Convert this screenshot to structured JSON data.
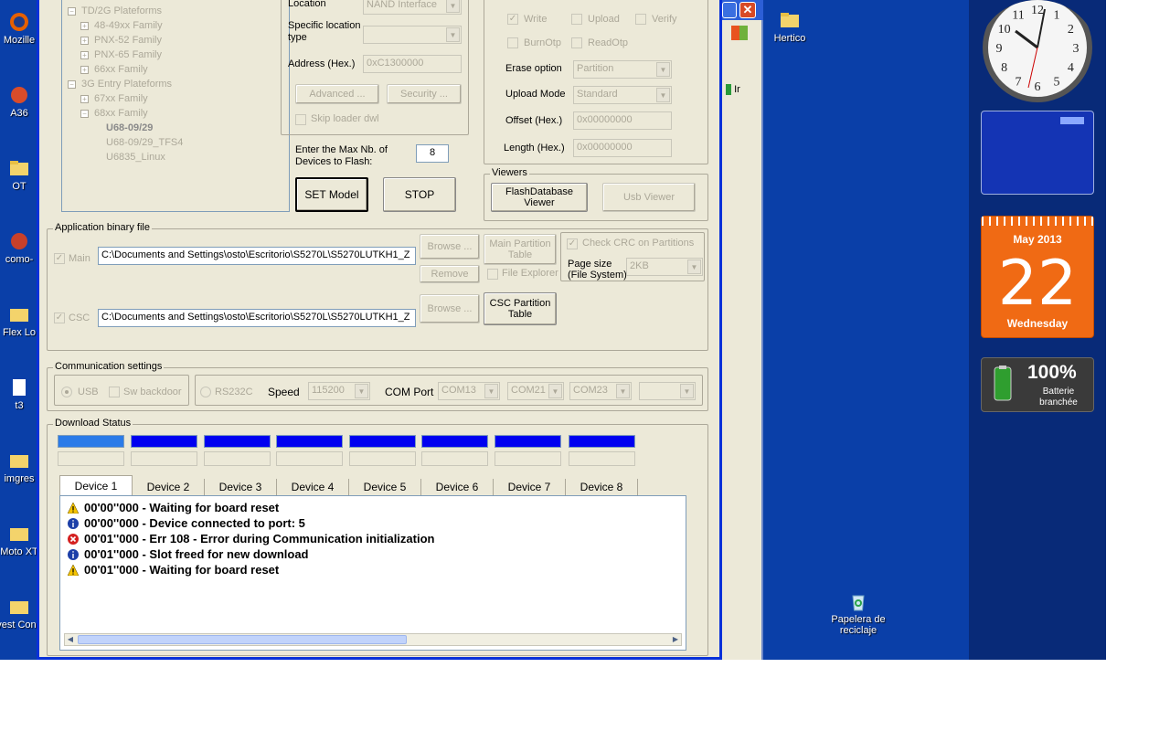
{
  "tree": {
    "items": [
      {
        "label": "TD/2G Plateforms",
        "sign": "−"
      },
      {
        "label": "48-49xx Family",
        "sign": "+"
      },
      {
        "label": "PNX-52 Family",
        "sign": "+"
      },
      {
        "label": "PNX-65 Family",
        "sign": "+"
      },
      {
        "label": "66xx Family",
        "sign": "+"
      },
      {
        "label": "3G Entry Plateforms",
        "sign": "−"
      },
      {
        "label": "67xx Family",
        "sign": "+"
      },
      {
        "label": "68xx Family",
        "sign": "−"
      },
      {
        "label": "U68-09/29",
        "sign": ""
      },
      {
        "label": "U68-09/29_TFS4",
        "sign": ""
      },
      {
        "label": "U6835_Linux",
        "sign": ""
      }
    ]
  },
  "location": {
    "label": "Location",
    "value": "NAND Interface",
    "specific_label": "Specific location type",
    "specific_value": "",
    "address_label": "Address (Hex.)",
    "address_value": "0xC1300000",
    "advanced_label": "Advanced ...",
    "security_label": "Security ...",
    "skip_loader_label": "Skip loader dwl"
  },
  "devices": {
    "max_label": "Enter the Max Nb. of Devices to Flash:",
    "max_value": "8",
    "set_model_label": "SET Model",
    "stop_label": "STOP"
  },
  "options": {
    "write_label": "Write",
    "upload_label": "Upload",
    "verify_label": "Verify",
    "burnotp_label": "BurnOtp",
    "readotp_label": "ReadOtp",
    "erase_label": "Erase option",
    "erase_value": "Partition",
    "upload_mode_label": "Upload Mode",
    "upload_mode_value": "Standard",
    "offset_label": "Offset (Hex.)",
    "offset_value": "0x00000000",
    "length_label": "Length (Hex.)",
    "length_value": "0x00000000"
  },
  "viewers": {
    "title": "Viewers",
    "flashdb_label": "FlashDatabase Viewer",
    "usb_label": "Usb Viewer"
  },
  "binary": {
    "title": "Application binary file",
    "main_label": "Main",
    "main_path": "C:\\Documents and Settings\\osto\\Escritorio\\S5270L\\S5270LUTKH1_Z",
    "csc_label": "CSC",
    "csc_path": "C:\\Documents and Settings\\osto\\Escritorio\\S5270L\\S5270LUTKH1_Z",
    "browse_label": "Browse ...",
    "remove_label": "Remove",
    "main_partition_label": "Main Partition Table",
    "csc_partition_label": "CSC Partition Table",
    "file_explorer_label": "File Explorer",
    "check_crc_label": "Check CRC on Partitions",
    "page_size_label": "Page size (File System)",
    "page_size_value": "2KB"
  },
  "comm": {
    "title": "Communication settings",
    "usb_label": "USB",
    "sw_backdoor_label": "Sw backdoor",
    "rs232_label": "RS232C",
    "speed_label": "Speed",
    "speed_value": "115200",
    "com_label": "COM Port",
    "ports": [
      "COM13",
      "COM21",
      "COM23",
      ""
    ]
  },
  "download": {
    "title": "Download Status",
    "tabs": [
      "Device 1",
      "Device 2",
      "Device 3",
      "Device 4",
      "Device 5",
      "Device 6",
      "Device 7",
      "Device 8"
    ],
    "log": [
      {
        "icon": "warning-icon",
        "text": "00'00''000 - Waiting for board reset"
      },
      {
        "icon": "info-icon",
        "text": "00'00''000 - Device connected to port: 5"
      },
      {
        "icon": "error-icon",
        "text": "00'01''000 - Err 108 - Error during Communication initialization"
      },
      {
        "icon": "info-icon",
        "text": "00'01''000 - Slot freed for new download"
      },
      {
        "icon": "warning-icon",
        "text": "00'01''000 - Waiting for board reset"
      }
    ]
  },
  "desktop": {
    "icons": [
      {
        "label": "Mozille"
      },
      {
        "label": "A36"
      },
      {
        "label": "OT"
      },
      {
        "label": "como-"
      },
      {
        "label": "Flex Lo"
      },
      {
        "label": "t3"
      },
      {
        "label": "imgres"
      },
      {
        "label": "Moto XT"
      },
      {
        "label": "Invest Concre"
      }
    ],
    "hertico_label": "Hertico",
    "recycle_label": "Papelera de reciclaje",
    "side_window_label": "Ir"
  },
  "gadgets": {
    "calendar_month": "May 2013",
    "calendar_day": "22",
    "calendar_weekday": "Wednesday",
    "battery_percent": "100%",
    "battery_status": "Batterie branchée",
    "clock_numbers": [
      "12",
      "1",
      "2",
      "3",
      "4",
      "5",
      "6",
      "7",
      "8",
      "9",
      "10",
      "11"
    ]
  },
  "colors": {
    "desktop": "#0a3fa8",
    "progress": "#0000f0",
    "progress_active": "#2b7be8"
  }
}
